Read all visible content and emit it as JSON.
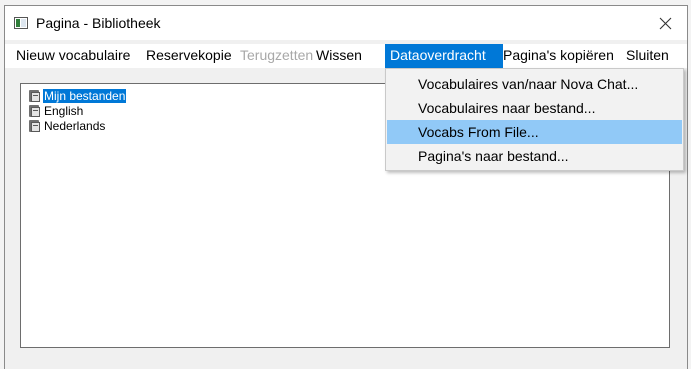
{
  "window": {
    "title": "Pagina - Bibliotheek",
    "app_icon": "window-app-icon",
    "close_icon": "close-icon"
  },
  "menubar": {
    "items": [
      {
        "label": "Nieuw vocabulaire",
        "state": "enabled"
      },
      {
        "label": "Reservekopie",
        "state": "enabled"
      },
      {
        "label": "Terugzetten",
        "state": "disabled"
      },
      {
        "label": "Wissen",
        "state": "enabled"
      },
      {
        "label": "Dataoverdracht",
        "state": "active"
      },
      {
        "label": "Pagina's kopiëren",
        "state": "enabled"
      },
      {
        "label": "Sluiten",
        "state": "enabled"
      }
    ]
  },
  "tree": {
    "items": [
      {
        "label": "Mijn bestanden",
        "selected": true,
        "icon": "folder-icon"
      },
      {
        "label": "English",
        "selected": false,
        "icon": "folder-icon"
      },
      {
        "label": "Nederlands",
        "selected": false,
        "icon": "folder-icon"
      }
    ]
  },
  "dropdown": {
    "items": [
      {
        "label": "Vocabulaires van/naar Nova Chat...",
        "hover": false
      },
      {
        "label": "Vocabulaires naar bestand...",
        "hover": false
      },
      {
        "label": "Vocabs From File...",
        "hover": true
      },
      {
        "label": "Pagina's naar bestand...",
        "hover": false
      }
    ]
  },
  "colors": {
    "menu_active": "#0078d7",
    "dropdown_hover": "#91c9f7",
    "selection": "#0078d7",
    "disabled_text": "#a8a8a8"
  }
}
